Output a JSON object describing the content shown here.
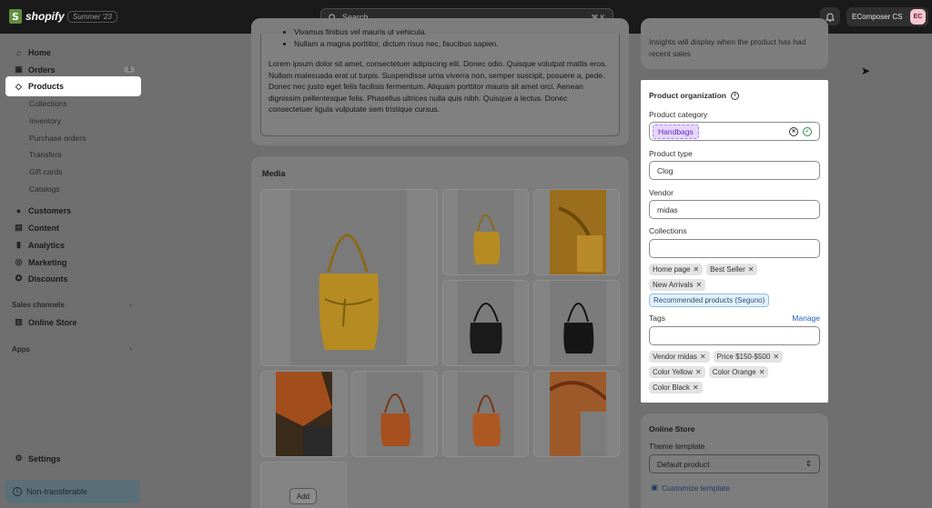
{
  "topbar": {
    "logo_text": "shopify",
    "edition": "Summer '23",
    "search_placeholder": "Search",
    "search_shortcut": "⌘ K",
    "account_name": "EComposer CS",
    "account_initials": "EC"
  },
  "sidebar": {
    "items": [
      {
        "label": "Home"
      },
      {
        "label": "Orders",
        "badge": "1"
      },
      {
        "label": "Products"
      },
      {
        "label": "Customers"
      },
      {
        "label": "Content"
      },
      {
        "label": "Analytics"
      },
      {
        "label": "Marketing"
      },
      {
        "label": "Discounts"
      }
    ],
    "product_subitems": [
      "Collections",
      "Inventory",
      "Purchase orders",
      "Transfers",
      "Gift cards",
      "Catalogs"
    ],
    "sales_channels_label": "Sales channels",
    "online_store_label": "Online Store",
    "apps_label": "Apps",
    "settings_label": "Settings",
    "non_transferable_label": "Non-transferable"
  },
  "description": {
    "bullets": [
      "Vivamus finibus vel mauris ut vehicula.",
      "Nullam a magna porttitor, dictum risus nec, faucibus sapien."
    ],
    "paragraph": "Lorem ipsum dolor sit amet, consectetuer adipiscing elit. Donec odio. Quisque volutpat mattis eros. Nullam malesuada erat ut turpis. Suspendisse urna viverra non, semper suscipit, posuere a, pede. Donec nec justo eget felis facilisis fermentum. Aliquam porttitor mauris sit amet orci. Aenean dignissim pellentesque felis. Phasellus ultrices nulla quis nibh. Quisque a lectus. Donec consectetuer ligula vulputate sem tristique cursus."
  },
  "media": {
    "title": "Media",
    "add_label": "Add"
  },
  "insights": {
    "text": "Insights will display when the product has had recent sales"
  },
  "organization": {
    "title": "Product organization",
    "category_label": "Product category",
    "category_value": "Handbags",
    "type_label": "Product type",
    "type_value": "Clog",
    "vendor_label": "Vendor",
    "vendor_value": "midas",
    "collections_label": "Collections",
    "collections": [
      "Home page",
      "Best Seller",
      "New Arrivals"
    ],
    "recommended_chip": "Recommended products (Seguno)",
    "tags_label": "Tags",
    "manage_label": "Manage",
    "tags": [
      "Vendor midas",
      "Price $150-$500",
      "Color Yellow",
      "Color Orange",
      "Color Black"
    ]
  },
  "online_store": {
    "title": "Online Store",
    "theme_label": "Theme template",
    "theme_value": "Default product",
    "customize_link": "Customize template"
  },
  "colors": {
    "accent_link": "#2463bc",
    "category_chip": "#e7d7ff",
    "brand_green": "#5e8e3e"
  }
}
